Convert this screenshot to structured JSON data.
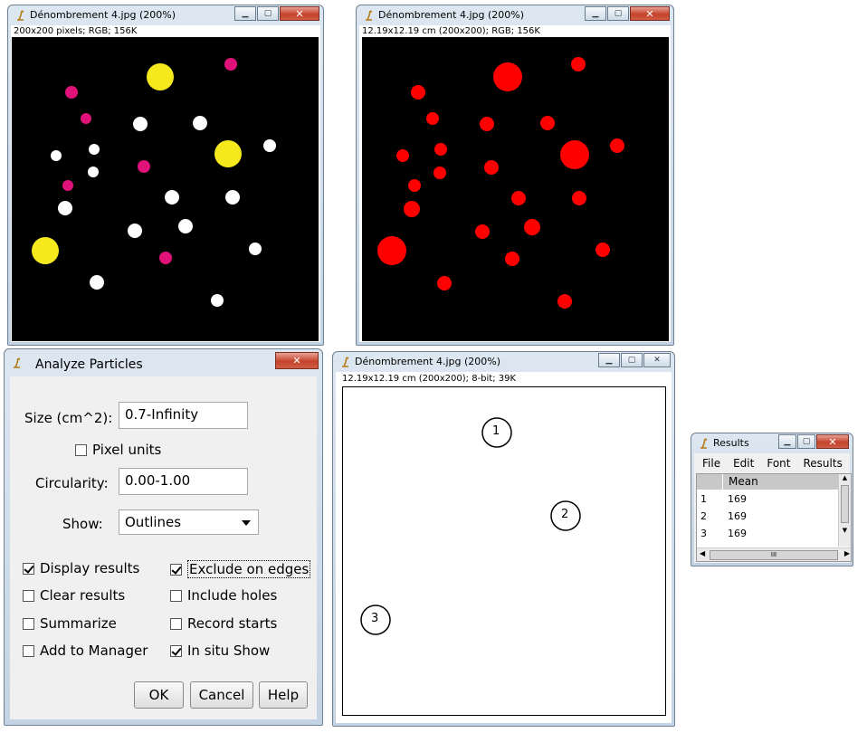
{
  "original_window": {
    "title": "Dénombrement 4.jpg (200%)",
    "info": "200x200 pixels; RGB; 156K",
    "controls": {
      "minimize": "▁",
      "maximize": "▢",
      "close": "✕"
    }
  },
  "red_window": {
    "title": "Dénombrement 4.jpg (200%)",
    "info": "12.19x12.19 cm (200x200); RGB; 156K"
  },
  "outline_window": {
    "title": "Dénombrement 4.jpg (200%)",
    "info": "12.19x12.19 cm (200x200); 8-bit; 39K",
    "particle_labels": [
      "1",
      "2",
      "3"
    ]
  },
  "analyze_dialog": {
    "title": "Analyze Particles",
    "size_label": "Size (cm^2):",
    "size_value": "0.7-Infinity",
    "pixel_units": {
      "label": "Pixel units",
      "checked": false
    },
    "circularity_label": "Circularity:",
    "circularity_value": "0.00-1.00",
    "show_label": "Show:",
    "show_value": "Outlines",
    "options": [
      {
        "label": "Display results",
        "checked": true
      },
      {
        "label": "Exclude on edges",
        "checked": true
      },
      {
        "label": "Clear results",
        "checked": false
      },
      {
        "label": "Include holes",
        "checked": false
      },
      {
        "label": "Summarize",
        "checked": false
      },
      {
        "label": "Record starts",
        "checked": false
      },
      {
        "label": "Add to Manager",
        "checked": false
      },
      {
        "label": "In situ Show",
        "checked": true
      }
    ],
    "buttons": {
      "ok": "OK",
      "cancel": "Cancel",
      "help": "Help"
    }
  },
  "results_window": {
    "title": "Results",
    "menu": [
      "File",
      "Edit",
      "Font",
      "Results"
    ],
    "column": "Mean",
    "rows": [
      {
        "index": "1",
        "mean": "169"
      },
      {
        "index": "2",
        "mean": "169"
      },
      {
        "index": "3",
        "mean": "169"
      }
    ],
    "scroll_grip": "III"
  },
  "colors": {
    "yellow": "#f5e91e",
    "magenta": "#e0127a",
    "white": "#ffffff",
    "red": "#ff0000"
  }
}
